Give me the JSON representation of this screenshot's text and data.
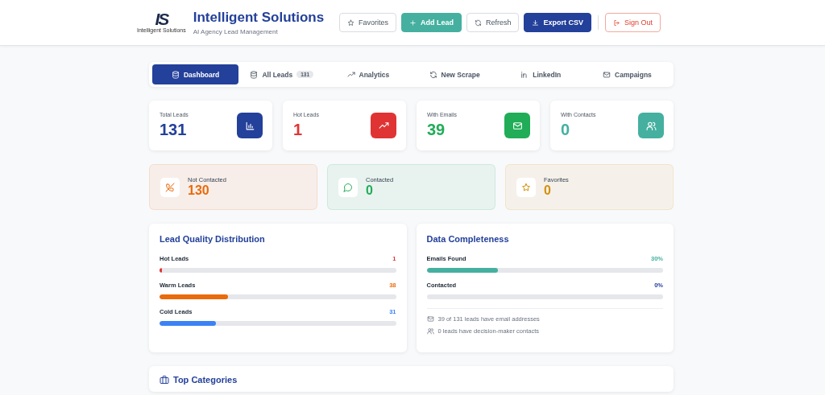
{
  "header": {
    "logo": {
      "mark": "IS",
      "caption": "Intelligent Solutions"
    },
    "title": "Intelligent Solutions",
    "subtitle": "AI Agency Lead Management",
    "buttons": [
      {
        "label": "Favorites",
        "kind": "outline"
      },
      {
        "label": "Add Lead",
        "kind": "teal"
      },
      {
        "label": "Refresh",
        "kind": "outline"
      },
      {
        "label": "Export CSV",
        "kind": "navy"
      },
      {
        "label": "Sign Out",
        "kind": "danger"
      }
    ]
  },
  "tabs": [
    {
      "label": "Dashboard",
      "selected": true
    },
    {
      "label": "All Leads",
      "badge": "131",
      "selected": false
    },
    {
      "label": "Analytics",
      "selected": false
    },
    {
      "label": "New Scrape",
      "selected": false
    },
    {
      "label": "LinkedIn",
      "selected": false
    },
    {
      "label": "Campaigns",
      "selected": false
    }
  ],
  "stats": [
    {
      "label": "Total Leads",
      "value": "131",
      "color": "#23409a"
    },
    {
      "label": "Hot Leads",
      "value": "1",
      "color": "#e03434"
    },
    {
      "label": "With Emails",
      "value": "39",
      "color": "#21ad57"
    },
    {
      "label": "With Contacts",
      "value": "0",
      "color": "#45b0a0"
    }
  ],
  "status_cards": [
    {
      "label": "Not Contacted",
      "value": "130",
      "color": "#ea6a0c"
    },
    {
      "label": "Contacted",
      "value": "0",
      "color": "#21ad57"
    },
    {
      "label": "Favorites",
      "value": "0",
      "color": "#d4900a"
    }
  ],
  "quality": {
    "title": "Lead Quality Distribution",
    "rows": [
      {
        "label": "Hot Leads",
        "value": "1",
        "level": 0.01,
        "color": "#e03434"
      },
      {
        "label": "Warm Leads",
        "value": "38",
        "level": 0.29,
        "color": "#ea6a0c"
      },
      {
        "label": "Cold Leads",
        "value": "31",
        "level": 0.24,
        "color": "#3b82f6"
      }
    ]
  },
  "completeness": {
    "title": "Data Completeness",
    "rows": [
      {
        "label": "Emails Found",
        "value": "30%",
        "level": 0.3,
        "color": "#45b0a0"
      },
      {
        "label": "Contacted",
        "value": "0%",
        "level": 0,
        "color": "#23409a"
      }
    ],
    "notes": [
      "39 of 131 leads have email addresses",
      "0 leads have decision-maker contacts"
    ]
  },
  "categories": {
    "title": "Top Categories"
  }
}
